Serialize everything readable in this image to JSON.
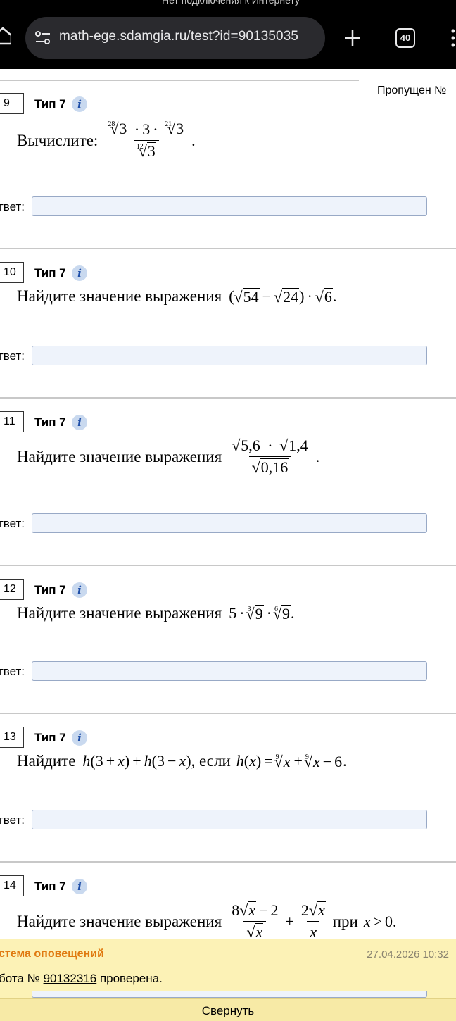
{
  "browser": {
    "status_text": "Нет подключения к Интернету",
    "url": "math-ege.sdamgia.ru/test?id=90135035",
    "tabs_count": "40"
  },
  "page": {
    "skipped": "Пропущен №"
  },
  "answer_label": "твет:",
  "tasks": [
    {
      "num": "9",
      "type": "Тип 7",
      "text": "Вычислите:"
    },
    {
      "num": "10",
      "type": "Тип 7",
      "text": "Найдите значение выражения"
    },
    {
      "num": "11",
      "type": "Тип 7",
      "text": "Найдите значение выражения"
    },
    {
      "num": "12",
      "type": "Тип 7",
      "text": "Найдите значение выражения"
    },
    {
      "num": "13",
      "type": "Тип 7",
      "text": "Найдите",
      "mid": ", если"
    },
    {
      "num": "14",
      "type": "Тип 7",
      "text": "Найдите значение выражения",
      "mid": "при"
    }
  ],
  "notification": {
    "title": "стема оповещений",
    "time": "27.04.2026 10:32",
    "prefix": "бота №",
    "link": "90132316",
    "suffix": "проверена.",
    "collapse": "Свернуть"
  },
  "colors": {
    "notify_bg": "#fcf2b6",
    "notify_title": "#e07a10",
    "info_icon": "#1f4fa8",
    "input_bg": "#eef3fb"
  }
}
